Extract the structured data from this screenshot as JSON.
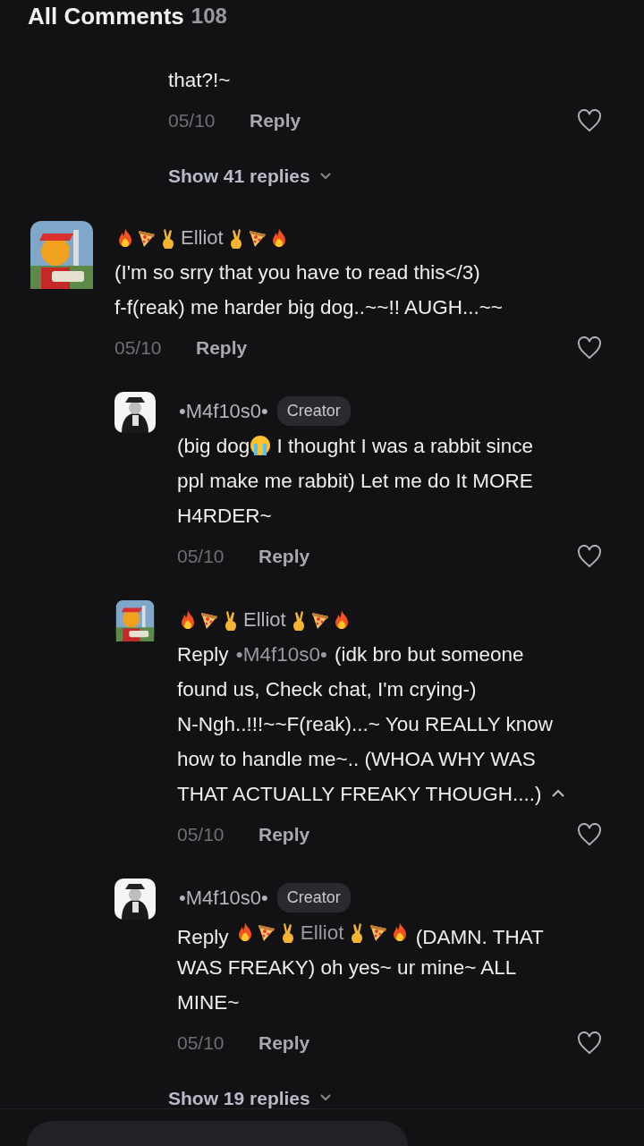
{
  "header": {
    "title": "All Comments",
    "count": "108"
  },
  "threads": [
    {
      "replies": [
        {
          "lines": [
            [
              {
                "kind": "text",
                "text": "that?!~"
              }
            ]
          ],
          "date": "05/10",
          "reply_label": "Reply",
          "liked": false
        }
      ],
      "show_more": "Show 41 replies"
    },
    {
      "comment": {
        "author": "Elliot",
        "flair": true,
        "lines": [
          [
            {
              "kind": "text",
              "text": "(I'm so srry that you have to read this</3)"
            }
          ],
          [
            {
              "kind": "text",
              "text": "f-f(reak) me harder big dog..~~!! AUGH...~~"
            }
          ]
        ],
        "date": "05/10",
        "reply_label": "Reply",
        "liked": false
      },
      "replies": [
        {
          "author": "•M4f10s0•",
          "badge": "Creator",
          "lines": [
            [
              {
                "kind": "text",
                "text": "(big dog"
              },
              {
                "kind": "crying-emoji"
              },
              {
                "kind": "text",
                "text": " I thought I was a rabbit since"
              }
            ],
            [
              {
                "kind": "text",
                "text": "ppl make me rabbit) Let me do It MORE"
              }
            ],
            [
              {
                "kind": "text",
                "text": "H4RDER~"
              }
            ]
          ],
          "date": "05/10",
          "reply_label": "Reply",
          "liked": false
        },
        {
          "author": "Elliot",
          "flair": true,
          "lines": [
            [
              {
                "kind": "text",
                "text": "Reply "
              },
              {
                "kind": "mention",
                "text": "•M4f10s0•"
              },
              {
                "kind": "text",
                "text": " (idk bro but someone"
              }
            ],
            [
              {
                "kind": "text",
                "text": "found us, Check chat, I'm crying-)"
              }
            ],
            [
              {
                "kind": "text",
                "text": "N-Ngh..!!!~~F(reak)...~ You REALLY know"
              }
            ],
            [
              {
                "kind": "text",
                "text": "how to handle me~.. (WHOA WHY WAS"
              }
            ],
            [
              {
                "kind": "text",
                "text": "THAT ACTUALLY FREAKY THOUGH....)"
              }
            ]
          ],
          "date": "05/10",
          "reply_label": "Reply",
          "liked": false,
          "expanded": true
        },
        {
          "author": "•M4f10s0•",
          "badge": "Creator",
          "lines": [
            [
              {
                "kind": "text",
                "text": "Reply "
              },
              {
                "kind": "mention",
                "text": "Elliot",
                "flair": true
              },
              {
                "kind": "text",
                "text": " (DAMN. THAT"
              }
            ],
            [
              {
                "kind": "text",
                "text": "WAS FREAKY) oh yes~ ur mine~ ALL"
              }
            ],
            [
              {
                "kind": "text",
                "text": "MINE~"
              }
            ]
          ],
          "date": "05/10",
          "reply_label": "Reply",
          "liked": false
        }
      ],
      "show_more": "Show 19 replies"
    }
  ]
}
